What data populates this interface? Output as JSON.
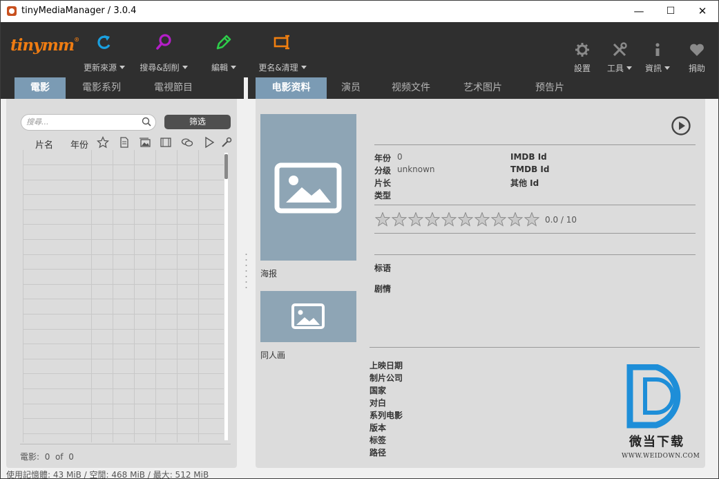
{
  "window": {
    "title": "tinyMediaManager / 3.0.4",
    "minimize": "—",
    "maximize": "☐",
    "close": "✕"
  },
  "logo": {
    "text": "tinymm",
    "mark": "®"
  },
  "toolbar": {
    "update_sources": "更新來源",
    "search_scrape": "搜尋&刮削",
    "edit": "編輯",
    "rename_clean": "更名&清理",
    "settings": "設置",
    "tools": "工具",
    "info": "資訊",
    "donate": "捐助"
  },
  "left_tabs": [
    "電影",
    "電影系列",
    "電視節目"
  ],
  "right_tabs": [
    "电影资料",
    "演员",
    "视频文件",
    "艺术图片",
    "预告片"
  ],
  "movie_list": {
    "search_placeholder": "搜尋...",
    "filter_label": "筛选",
    "col_title": "片名",
    "col_year": "年份",
    "count_label": "電影:",
    "count_value": "0",
    "count_of": "of",
    "count_total": "0"
  },
  "details": {
    "poster_label": "海报",
    "fanart_label": "同人画",
    "year_label": "年份",
    "year_value": "0",
    "cert_label": "分级",
    "cert_value": "unknown",
    "runtime_label": "片长",
    "genre_label": "类型",
    "imdb_label": "IMDB Id",
    "tmdb_label": "TMDB Id",
    "other_label": "其他 Id",
    "rating_text": "0.0 / 10",
    "rating_value": 0,
    "rating_max": 10,
    "tagline_label": "标语",
    "plot_label": "剧情",
    "release_label": "上映日期",
    "production_label": "制片公司",
    "country_label": "国家",
    "spoken_label": "对白",
    "movieset_label": "系列电影",
    "edition_label": "版本",
    "tags_label": "标签",
    "path_label": "路径"
  },
  "status": {
    "memory_text": "使用記憶體: 43 MiB / 空閒: 468 MiB / 最大: 512 MiB"
  },
  "watermark": {
    "name": "微当下载",
    "url": "WWW.WEIDOWN.COM"
  },
  "colors": {
    "toolbar_bg": "#2f2f2f",
    "accent_tab": "#7b9bb4",
    "logo": "#ef7c12",
    "refresh_icon": "#1aa0e0",
    "search_icon": "#b41ec8",
    "edit_icon": "#2ecc4a",
    "rename_icon": "#f07f10",
    "image_placeholder": "#8ea5b5",
    "watermark_blue": "#1e8ed8"
  }
}
